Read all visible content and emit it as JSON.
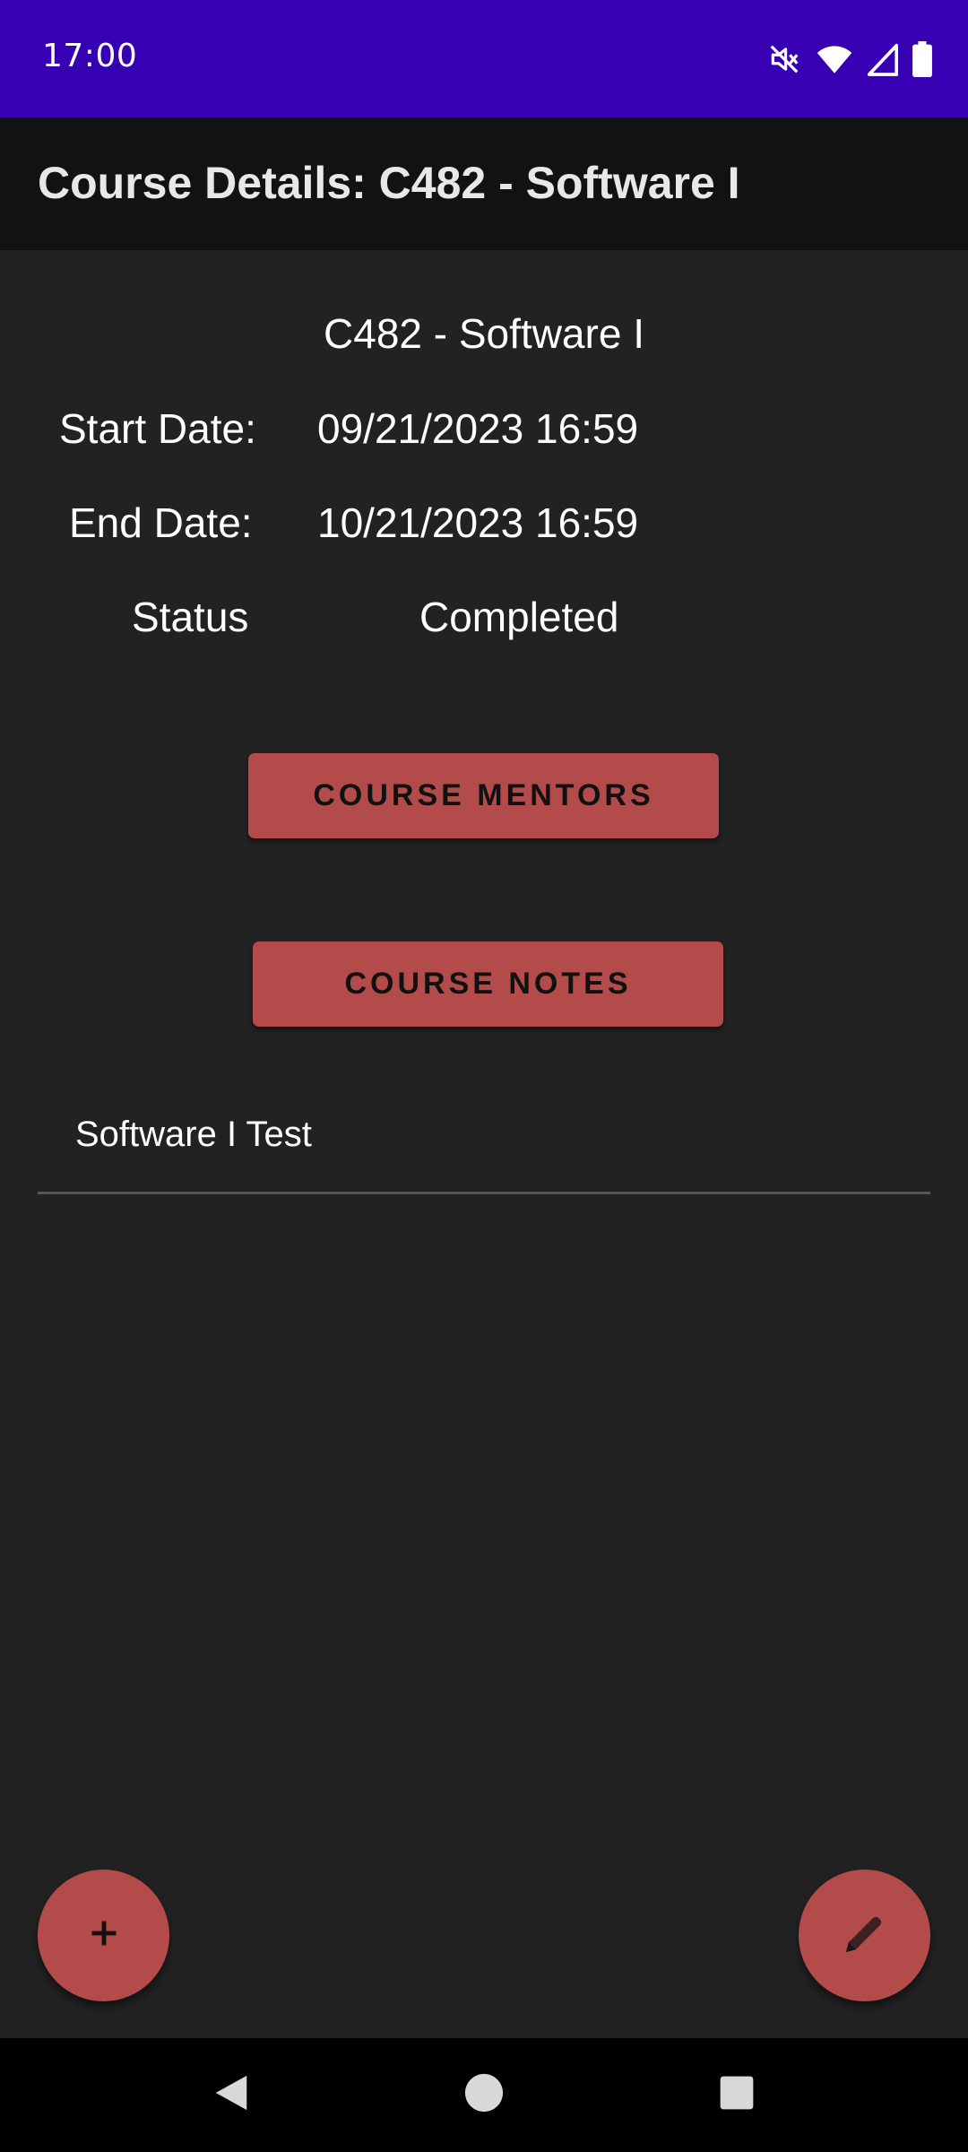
{
  "status_bar": {
    "time": "17:00",
    "icons": [
      "mute-icon",
      "wifi-icon",
      "signal-icon",
      "battery-icon"
    ],
    "background": "#3700b3"
  },
  "app_bar": {
    "title": "Course Details: C482 - Software I"
  },
  "course": {
    "title": "C482 - Software I",
    "start_label": "Start Date:",
    "start_value": "09/21/2023 16:59",
    "end_label": "End Date:",
    "end_value": "10/21/2023 16:59",
    "status_label": "Status",
    "status_value": "Completed"
  },
  "buttons": {
    "mentors_label": "COURSE MENTORS",
    "notes_label": "COURSE NOTES"
  },
  "assessments": [
    {
      "label": "Software I Test"
    }
  ],
  "fabs": {
    "add_icon": "plus-icon",
    "edit_icon": "pencil-icon"
  },
  "nav_bar": {
    "icons": [
      "back-icon",
      "home-icon",
      "recents-icon"
    ]
  },
  "colors": {
    "accent": "#b34b4a",
    "background": "#232223",
    "app_bar": "#121212"
  }
}
